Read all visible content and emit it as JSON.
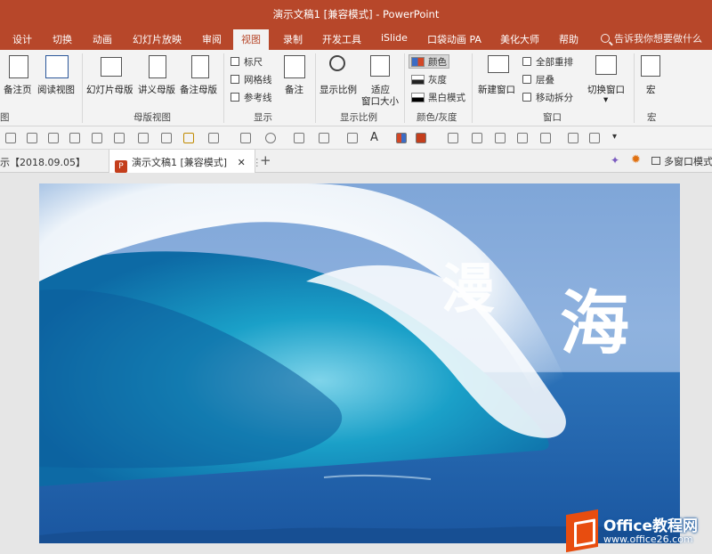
{
  "window": {
    "title": "演示文稿1 [兼容模式] - PowerPoint"
  },
  "ribbon_tabs": [
    {
      "label": "设计"
    },
    {
      "label": "切换"
    },
    {
      "label": "动画"
    },
    {
      "label": "幻灯片放映"
    },
    {
      "label": "审阅"
    },
    {
      "label": "视图",
      "active": true
    },
    {
      "label": "录制"
    },
    {
      "label": "开发工具"
    },
    {
      "label": "iSlide"
    },
    {
      "label": "口袋动画 PA"
    },
    {
      "label": "美化大师"
    },
    {
      "label": "帮助"
    }
  ],
  "tell_me": {
    "placeholder": "告诉我你想要做什么"
  },
  "ribbon": {
    "views": {
      "notes_page": "备注页",
      "reading_view": "阅读视图",
      "group": "图"
    },
    "master": {
      "slide_master": "幻灯片母版",
      "handout_master": "讲义母版",
      "notes_master": "备注母版",
      "group": "母版视图"
    },
    "show": {
      "ruler": "标尺",
      "gridlines": "网格线",
      "guides": "参考线",
      "notes": "备注",
      "group": "显示"
    },
    "zoom": {
      "zoom": "显示比例",
      "fit_line1": "适应",
      "fit_line2": "窗口大小",
      "group": "显示比例"
    },
    "color": {
      "color": "颜色",
      "grayscale": "灰度",
      "bw": "黑白模式",
      "group": "颜色/灰度"
    },
    "window": {
      "new_window": "新建窗口",
      "arrange_all": "全部重排",
      "cascade": "层叠",
      "move_split": "移动拆分",
      "switch_windows": "切换窗口",
      "group": "窗口"
    },
    "macros": {
      "macros": "宏",
      "group": "宏"
    }
  },
  "doc_tabs": {
    "left": "示【2018.09.05】",
    "active": "演示文稿1 [兼容模式]",
    "right": "多窗口模式"
  },
  "slide": {
    "visible_chars": [
      "漫",
      "海"
    ]
  },
  "watermark": {
    "brand": "Office教程网",
    "url": "www.office26.com"
  }
}
